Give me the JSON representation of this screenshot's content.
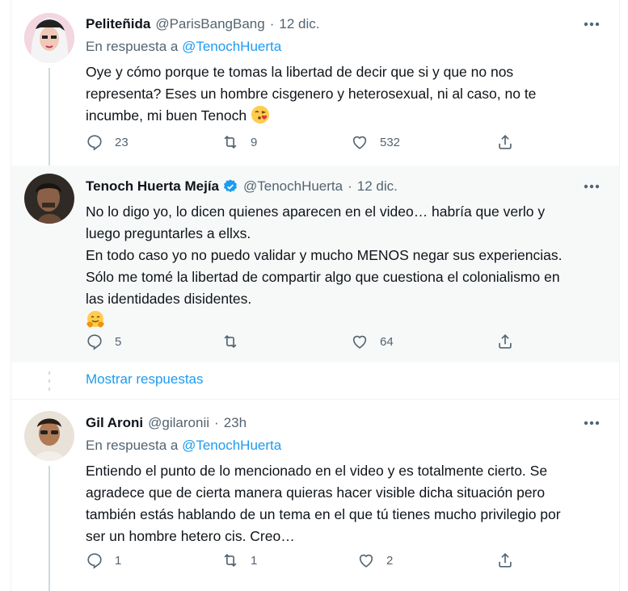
{
  "tweets": [
    {
      "name": "Peliteñida",
      "handle": "@ParisBangBang",
      "dot": "·",
      "time": "12 dic.",
      "reply_prefix": "En respuesta a",
      "reply_handle": "@TenochHuerta",
      "text_lines": [
        "Oye y cómo porque te tomas la libertad de decir que si y que no nos",
        "representa? Eses un hombre cisgenero y heterosexual, ni al caso, no te",
        "incumbe, mi buen Tenoch"
      ],
      "emoji": "face-blowing-kiss",
      "replies": "23",
      "retweets": "9",
      "likes": "532"
    },
    {
      "name": "Tenoch Huerta Mejía",
      "handle": "@TenochHuerta",
      "dot": "·",
      "time": "12 dic.",
      "text_lines": [
        "No lo digo yo, lo dicen quienes aparecen en el video… habría que verlo y",
        "luego preguntarles a ellxs.",
        "En todo caso yo no puedo validar y mucho MENOS negar sus experiencias.",
        "Sólo me tomé la libertad de compartir algo que cuestiona el colonialismo en",
        "las identidades disidentes."
      ],
      "emoji": "hugging-face",
      "replies": "5",
      "retweets": "",
      "likes": "64"
    },
    {
      "name": "Gil Aroni",
      "handle": "@gilaronii",
      "dot": "·",
      "time": "23h",
      "reply_prefix": "En respuesta a",
      "reply_handle": "@TenochHuerta",
      "text_lines": [
        "Entiendo el punto de lo mencionado en el video y es totalmente cierto. Se",
        "agradece que de cierta manera quieras hacer visible dicha situación pero",
        "también estás hablando de un tema en el que tú tienes mucho privilegio por",
        "ser un hombre hetero cis. Creo…"
      ],
      "replies": "1",
      "retweets": "1",
      "likes": "2"
    }
  ],
  "show_replies": "Mostrar respuestas",
  "colors": {
    "accent": "#1d9bf0",
    "muted": "#536471",
    "highlight_bg": "#f7f9f9"
  }
}
